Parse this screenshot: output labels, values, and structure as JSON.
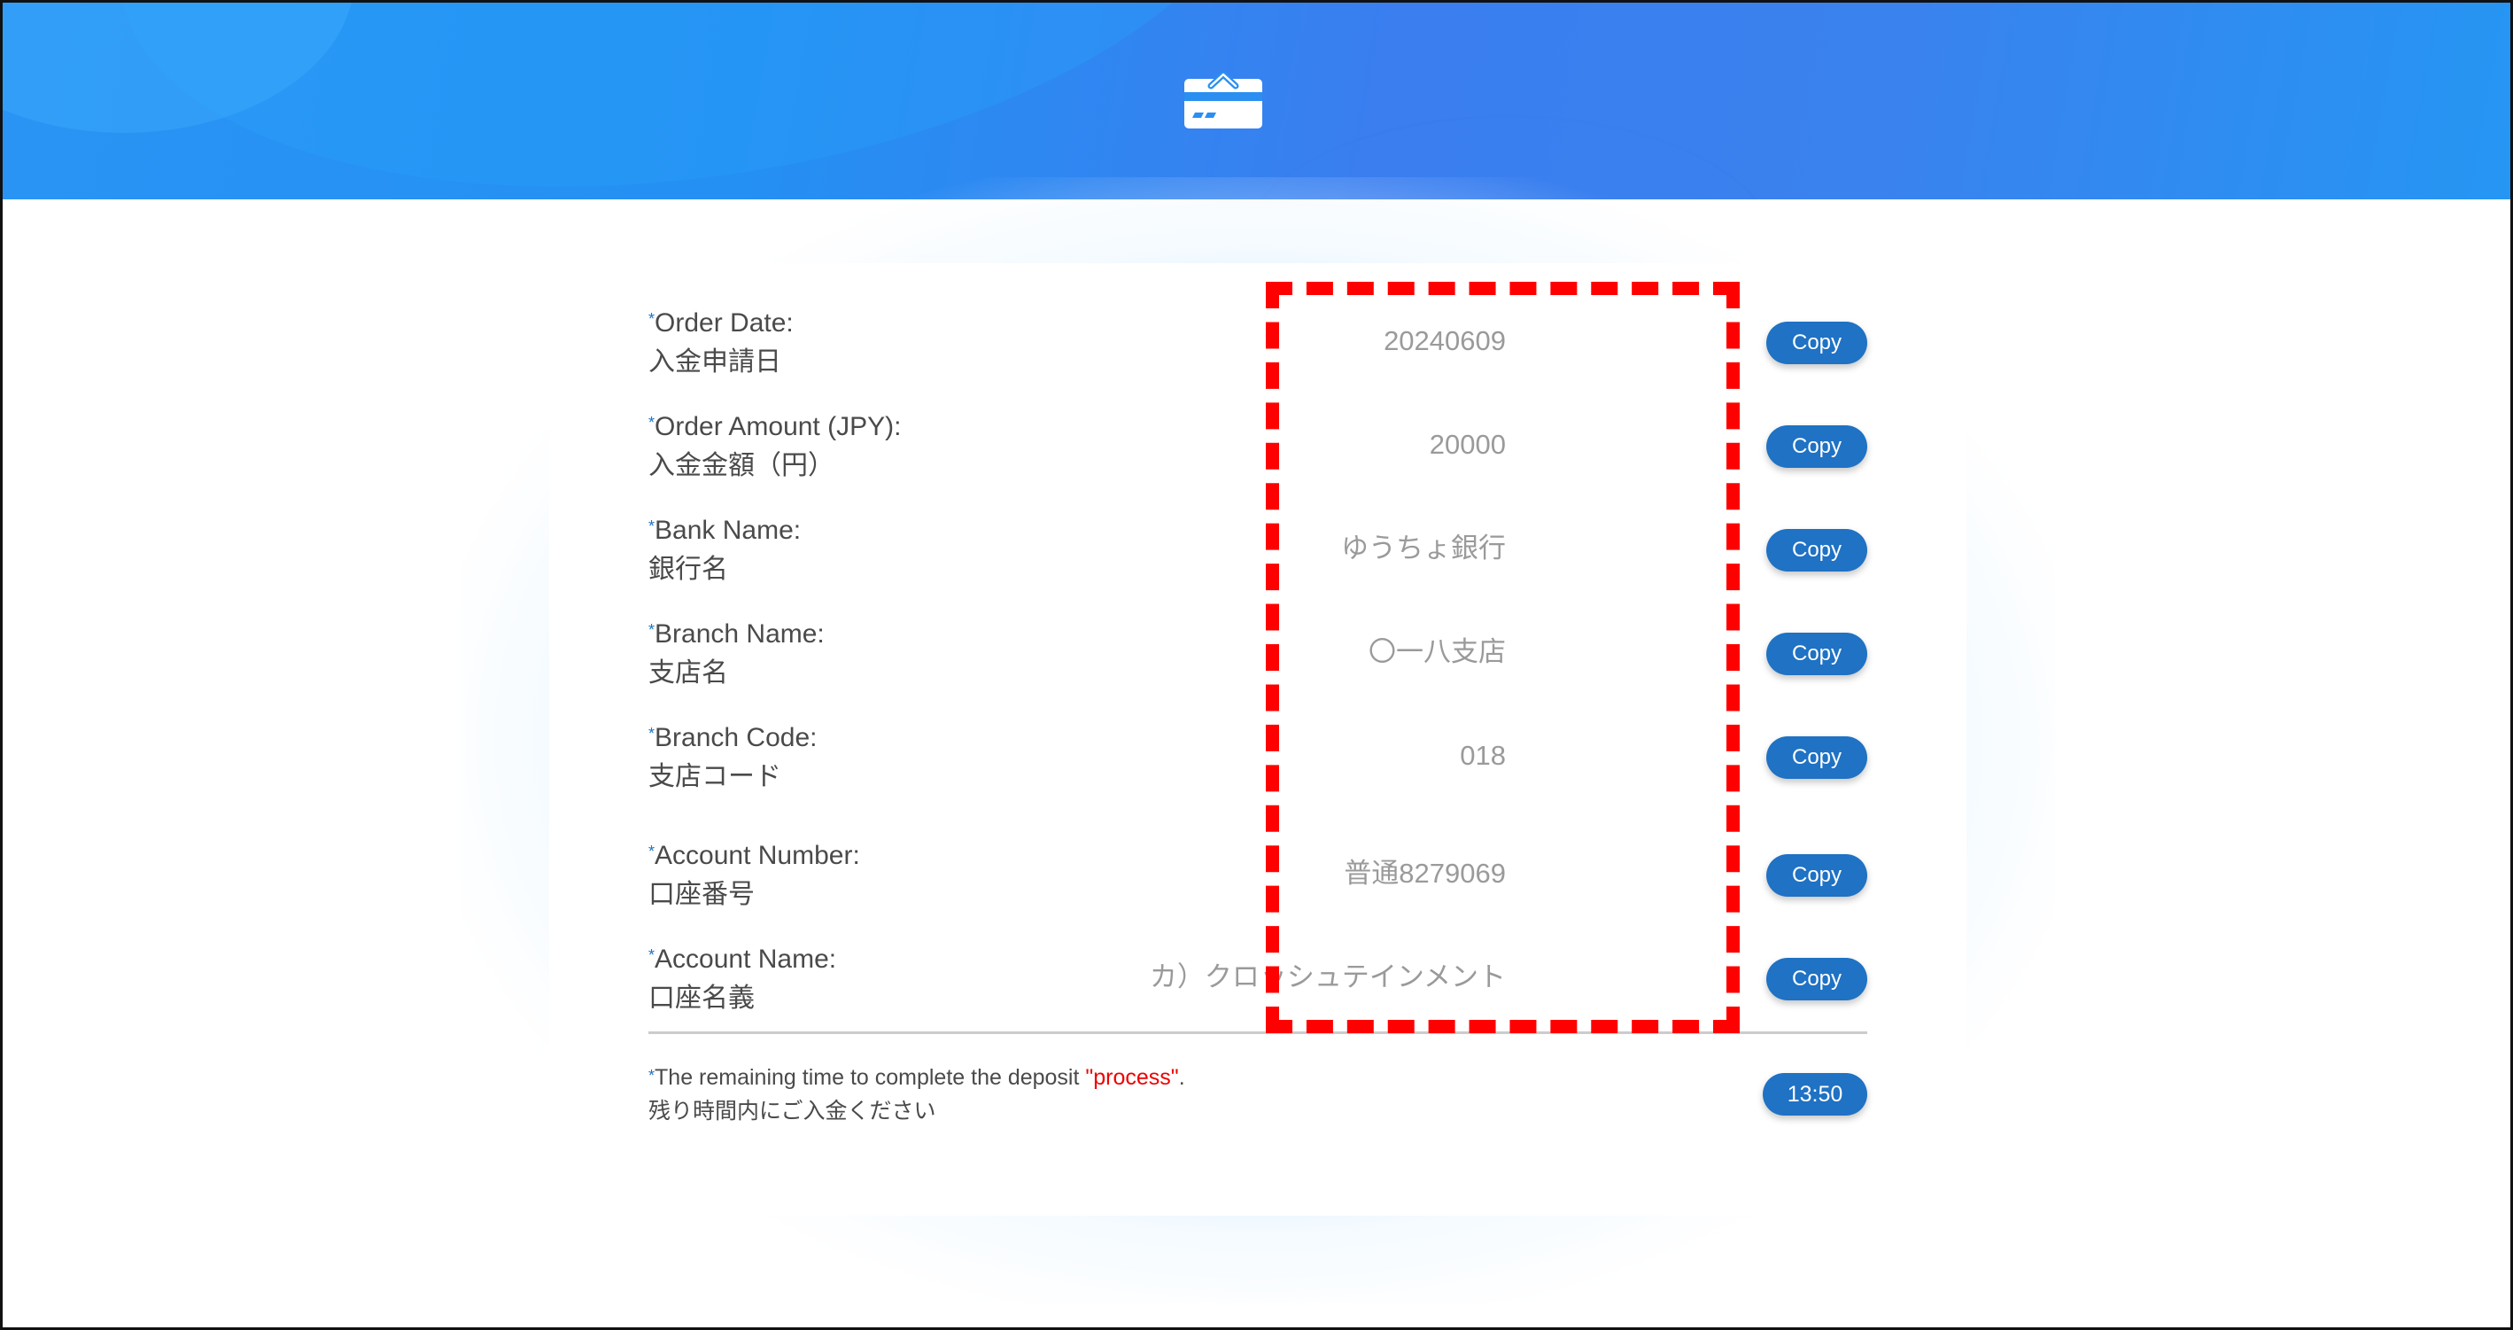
{
  "header": {
    "logo_icon": "payment-card-icon",
    "colors": {
      "gradient_start": "#2a94f4",
      "gradient_mid": "#3a7ef0",
      "gradient_end": "#2596f3"
    }
  },
  "required_marker": "*",
  "fields": [
    {
      "label_en": "Order Date:",
      "label_ja": "入金申請日",
      "value": "20240609",
      "copy_label": "Copy"
    },
    {
      "label_en": "Order Amount (JPY):",
      "label_ja": "入金金額（円）",
      "value": "20000",
      "copy_label": "Copy"
    },
    {
      "label_en": "Bank Name:",
      "label_ja": "銀行名",
      "value": "ゆうちょ銀行",
      "copy_label": "Copy"
    },
    {
      "label_en": "Branch Name:",
      "label_ja": "支店名",
      "value": "〇一八支店",
      "copy_label": "Copy"
    },
    {
      "label_en": "Branch Code:",
      "label_ja": "支店コード",
      "value": "018",
      "copy_label": "Copy"
    },
    {
      "label_en": "Account Number:",
      "label_ja": "口座番号",
      "value": "普通8279069",
      "copy_label": "Copy"
    },
    {
      "label_en": "Account Name:",
      "label_ja": "口座名義",
      "value": "カ）クロッシュテインメント",
      "copy_label": "Copy"
    }
  ],
  "timer": {
    "text_before": "The remaining time to complete the deposit ",
    "text_highlight": "\"process\"",
    "text_after": ".",
    "text_ja": "残り時間内にご入金ください",
    "remaining": "13:50"
  },
  "annotation": {
    "type": "red-dashed-highlight",
    "color": "#ff0000",
    "target": "field values"
  },
  "colors": {
    "button": "#1f72c4",
    "value_text": "#9a9a9a",
    "label_text": "#4a4a4a",
    "highlight_text": "#ee0000"
  }
}
